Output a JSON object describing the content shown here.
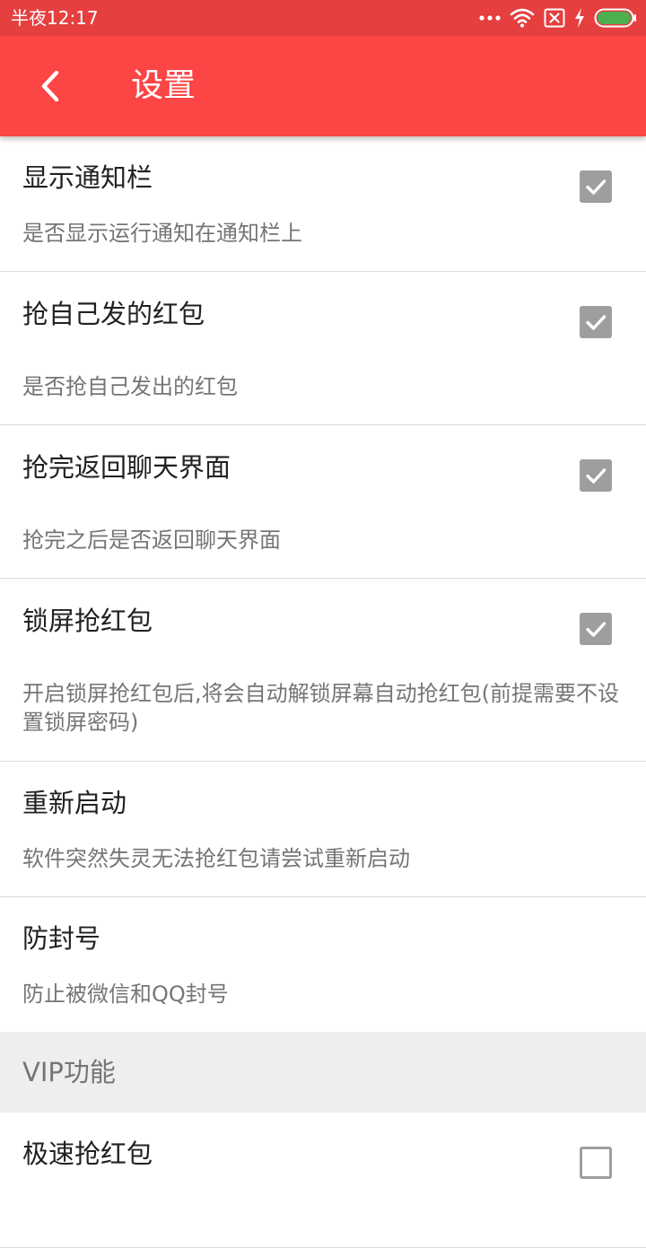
{
  "status_bar": {
    "time": "半夜12:17",
    "icons": [
      "more-dots-icon",
      "wifi-icon",
      "no-sim-icon",
      "charging-bolt-icon",
      "battery-icon"
    ]
  },
  "app_bar": {
    "back_icon": "back-arrow-icon",
    "title": "设置"
  },
  "settings": [
    {
      "title": "显示通知栏",
      "summary": "是否显示运行通知在通知栏上",
      "checked": true
    },
    {
      "title": "抢自己发的红包",
      "summary": "是否抢自己发出的红包",
      "checked": true
    },
    {
      "title": "抢完返回聊天界面",
      "summary": "抢完之后是否返回聊天界面",
      "checked": true
    },
    {
      "title": "锁屏抢红包",
      "summary": "开启锁屏抢红包后,将会自动解锁屏幕自动抢红包(前提需要不设置锁屏密码)",
      "checked": true
    },
    {
      "title": "重新启动",
      "summary": "软件突然失灵无法抢红包请尝试重新启动"
    },
    {
      "title": "防封号",
      "summary": "防止被微信和QQ封号"
    }
  ],
  "vip_category": {
    "title": "VIP功能"
  },
  "vip_settings": [
    {
      "title": "极速抢红包",
      "checked": false
    }
  ],
  "colors": {
    "status_bar": "#e53f3f",
    "app_bar": "#fc4545",
    "checkbox": "#9e9e9e",
    "category_bg": "#eeeeee",
    "battery": "#4caf50"
  }
}
